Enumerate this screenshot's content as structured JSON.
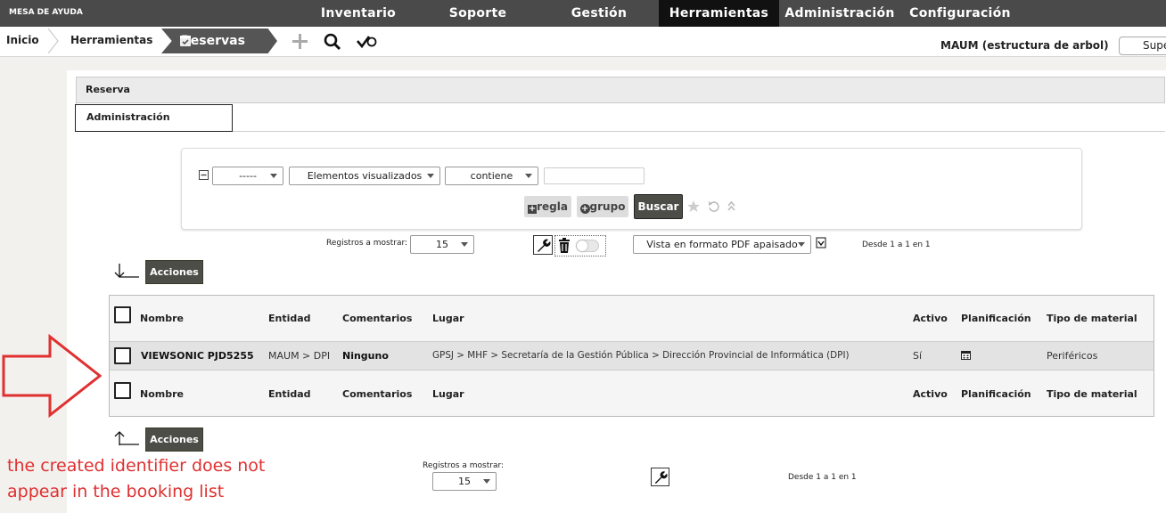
{
  "topbar": {
    "brand": "MESA DE AYUDA",
    "menu": [
      "Inventario",
      "Soporte",
      "Gestión",
      "Herramientas",
      "Administración",
      "Configuración"
    ],
    "active_menu": "Herramientas"
  },
  "breadcrumb": {
    "items": [
      "Inicio",
      "Herramientas",
      "Reservas"
    ]
  },
  "toolbar_icons": [
    "plus-icon",
    "search-icon",
    "check-icon"
  ],
  "header_right": {
    "entity": "MAUM (estructura de arbol)",
    "profile_select": "Super-Admin"
  },
  "panel": {
    "title": "Reserva",
    "tab": "Administración"
  },
  "filter": {
    "field1": "-----",
    "field2": "Elementos visualizados",
    "operator": "contiene",
    "value": "",
    "rule_button": "regla",
    "group_button": "grupo",
    "search_button": "Buscar"
  },
  "pager_top": {
    "label": "Registros a mostrar:",
    "count": "15",
    "export_option": "Vista en formato PDF apaisado",
    "range": "Desde 1 a 1 en 1"
  },
  "actions_label": "Acciones",
  "table": {
    "columns": [
      "Nombre",
      "Entidad",
      "Comentarios",
      "Lugar",
      "Activo",
      "Planificación",
      "Tipo de material"
    ],
    "rows": [
      {
        "nombre": "VIEWSONIC PJD5255",
        "entidad": "MAUM > DPI",
        "comentarios": "Ninguno",
        "lugar": "GPSJ > MHF > Secretaría de la Gestión Pública > Dirección Provincial de Informática (DPI)",
        "activo": "Sí",
        "tipo": "Periféricos"
      }
    ]
  },
  "pager_bottom": {
    "label": "Registros a mostrar:",
    "count": "15",
    "range": "Desde 1 a 1 en 1"
  },
  "annotation": {
    "line1": "the created identifier does not",
    "line2": "appear in the booking list",
    "color": "#e03030"
  }
}
